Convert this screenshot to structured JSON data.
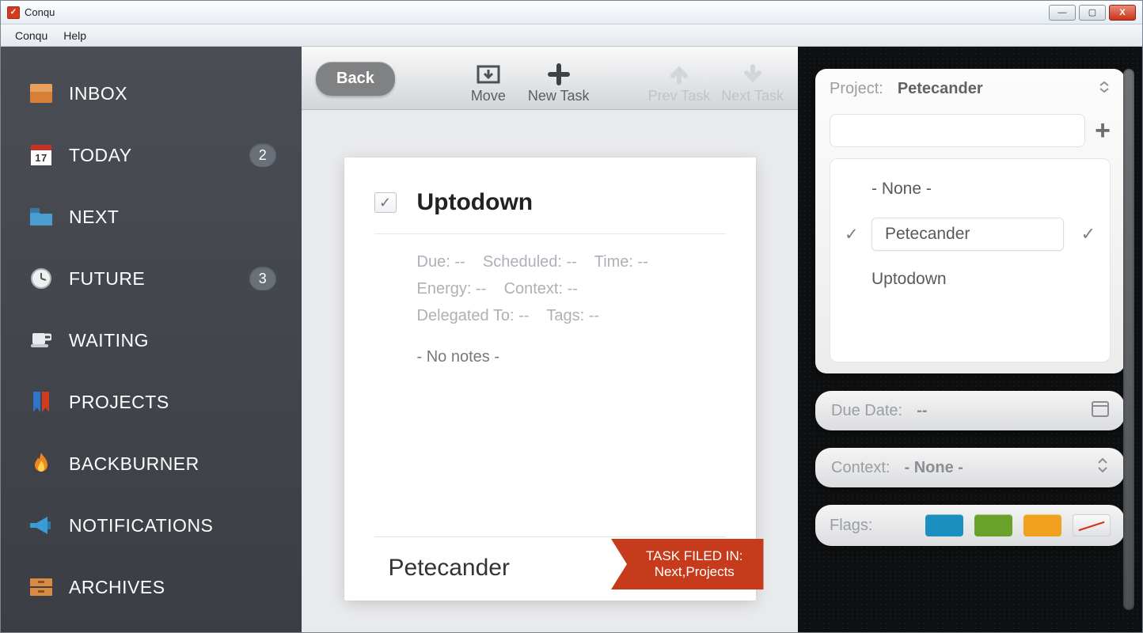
{
  "window": {
    "title": "Conqu"
  },
  "menubar": {
    "items": [
      "Conqu",
      "Help"
    ]
  },
  "sidebar": {
    "items": [
      {
        "label": "INBOX",
        "icon": "inbox",
        "badge": null
      },
      {
        "label": "TODAY",
        "icon": "calendar-17",
        "badge": "2"
      },
      {
        "label": "NEXT",
        "icon": "folder",
        "badge": null
      },
      {
        "label": "FUTURE",
        "icon": "clock",
        "badge": "3"
      },
      {
        "label": "WAITING",
        "icon": "cup",
        "badge": null
      },
      {
        "label": "PROJECTS",
        "icon": "bookmark",
        "badge": null
      },
      {
        "label": "BACKBURNER",
        "icon": "flame",
        "badge": null
      },
      {
        "label": "NOTIFICATIONS",
        "icon": "megaphone",
        "badge": null
      },
      {
        "label": "ARCHIVES",
        "icon": "drawer",
        "badge": null
      }
    ]
  },
  "toolbar": {
    "back": "Back",
    "move": "Move",
    "new_task": "New Task",
    "prev_task": "Prev Task",
    "next_task": "Next Task"
  },
  "task": {
    "title": "Uptodown",
    "checked": true,
    "meta": {
      "due_label": "Due:",
      "due_value": "--",
      "scheduled_label": "Scheduled:",
      "scheduled_value": "--",
      "time_label": "Time:",
      "time_value": "--",
      "energy_label": "Energy:",
      "energy_value": "--",
      "context_label": "Context:",
      "context_value": "--",
      "delegated_label": "Delegated To:",
      "delegated_value": "--",
      "tags_label": "Tags:",
      "tags_value": "--"
    },
    "notes": "- No notes -",
    "project": "Petecander",
    "ribbon_title": "TASK FILED IN:",
    "ribbon_value": "Next,Projects"
  },
  "rightpanel": {
    "project_label": "Project:",
    "project_value": "Petecander",
    "project_options": {
      "none": "- None -",
      "opt1": "Petecander",
      "opt2": "Uptodown"
    },
    "due_label": "Due Date:",
    "due_value": "--",
    "context_label": "Context:",
    "context_value": "- None -",
    "flags_label": "Flags:",
    "flag_colors": {
      "c1": "#1b8fbf",
      "c2": "#6aa12b",
      "c3": "#f0a11d"
    }
  }
}
